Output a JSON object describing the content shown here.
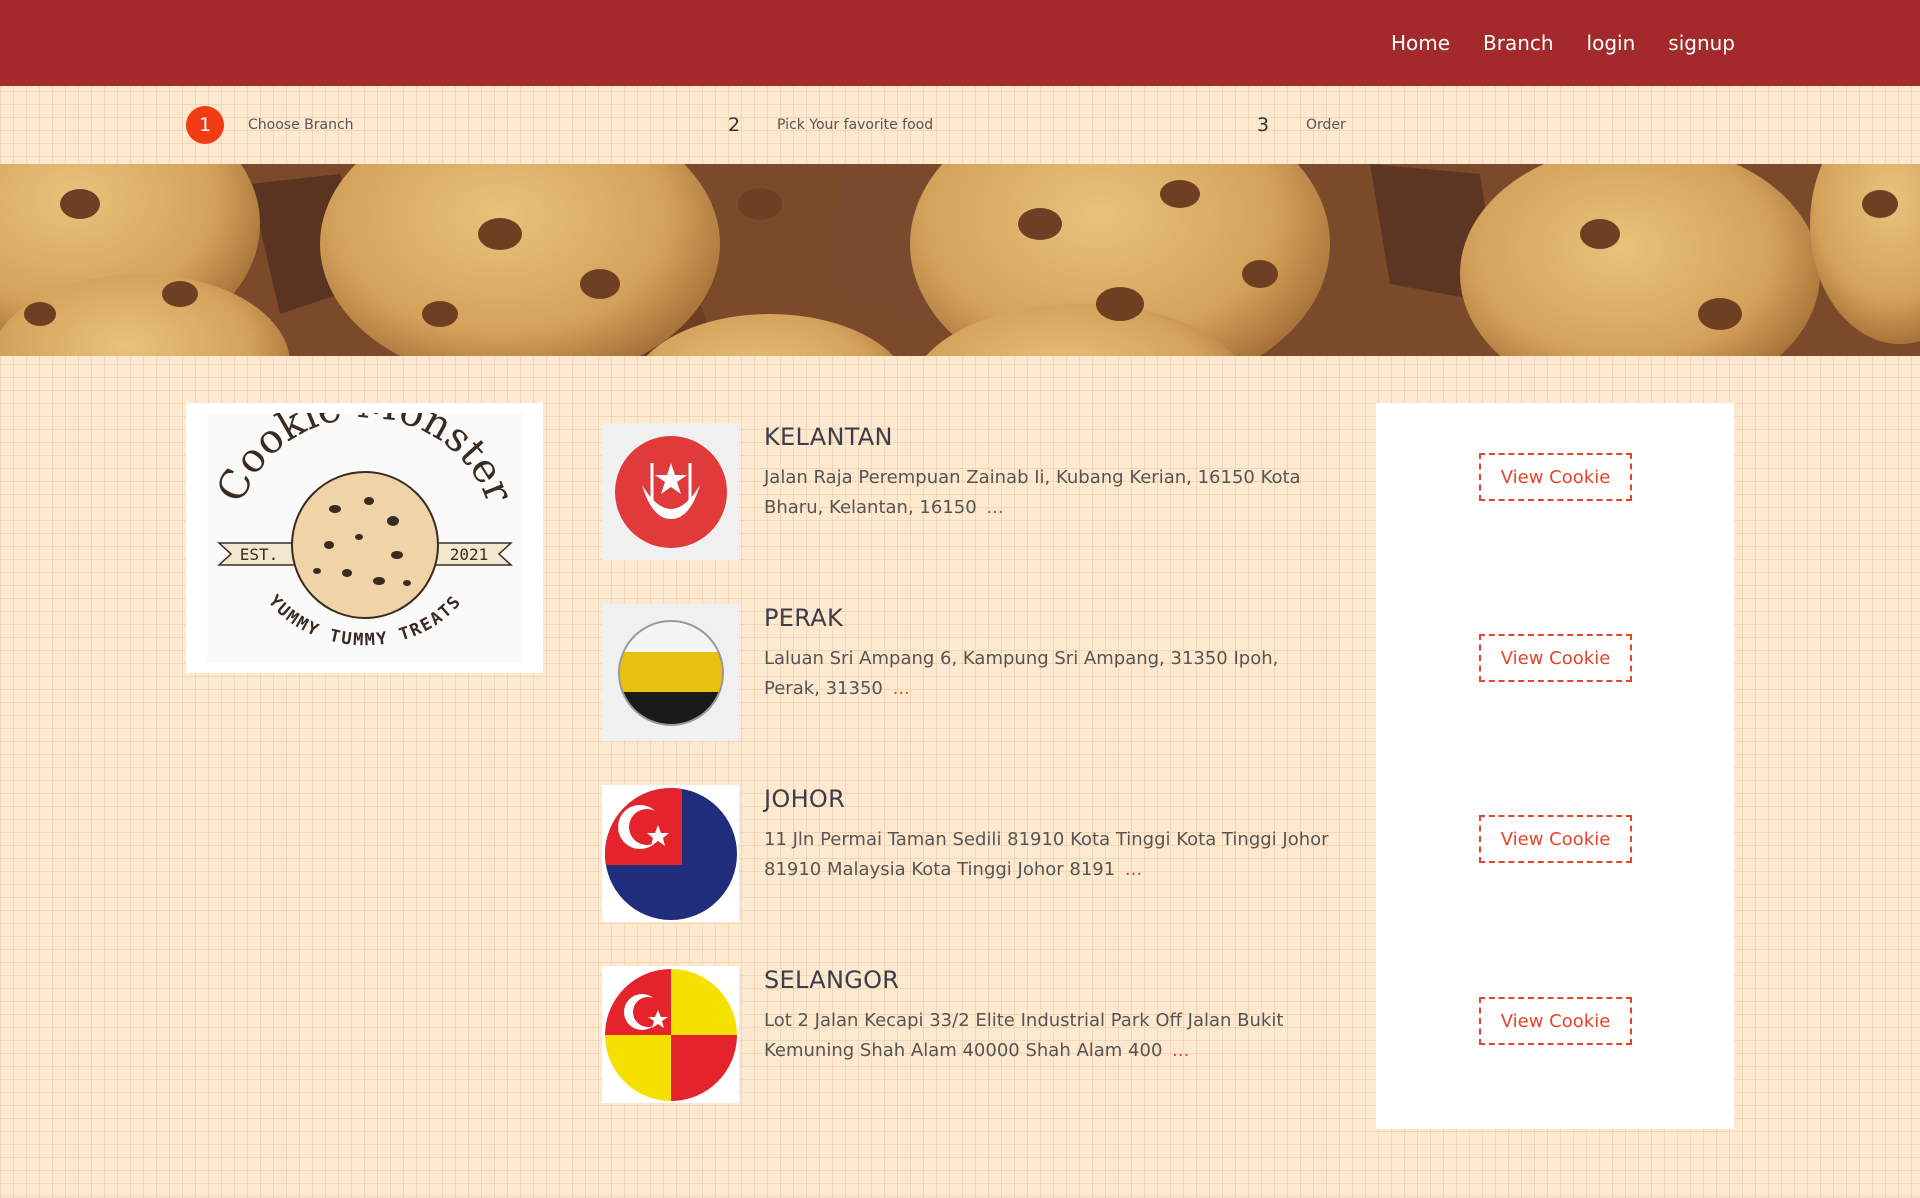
{
  "nav": {
    "items": [
      "Home",
      "Branch",
      "login",
      "signup"
    ]
  },
  "steps": [
    {
      "number": "1",
      "label": "Choose Branch",
      "active": true
    },
    {
      "number": "2",
      "label": "Pick Your favorite food",
      "active": false
    },
    {
      "number": "3",
      "label": "Order",
      "active": false
    }
  ],
  "logo": {
    "title": "Cookie Monster",
    "est_left": "EST.",
    "est_right": "2021",
    "tagline": "YUMMY TUMMY TREATS"
  },
  "branches": [
    {
      "name": "KELANTAN",
      "address": "Jalan Raja Perempuan Zainab Ii, Kubang Kerian, 16150 Kota Bharu, Kelantan, 16150",
      "more": "...",
      "flag": "kelantan-flag-icon"
    },
    {
      "name": "PERAK",
      "address": "Laluan Sri Ampang 6, Kampung Sri Ampang, 31350 Ipoh, Perak, 31350",
      "more": "...",
      "flag": "perak-flag-icon"
    },
    {
      "name": "JOHOR",
      "address": "11 Jln Permai Taman Sedili 81910 Kota Tinggi Kota Tinggi Johor 81910 Malaysia Kota Tinggi Johor 8191",
      "more": "...",
      "flag": "johor-flag-icon"
    },
    {
      "name": "SELANGOR",
      "address": "Lot 2 Jalan Kecapi 33/2 Elite Industrial Park Off Jalan Bukit Kemuning Shah Alam 40000 Shah Alam 400",
      "more": "...",
      "flag": "selangor-flag-icon"
    }
  ],
  "actions": {
    "view_label": "View Cookie"
  },
  "colors": {
    "navbar": "#a3292b",
    "accent": "#e0462a",
    "step_active": "#f03b13",
    "page_bg": "#fde9cf"
  }
}
